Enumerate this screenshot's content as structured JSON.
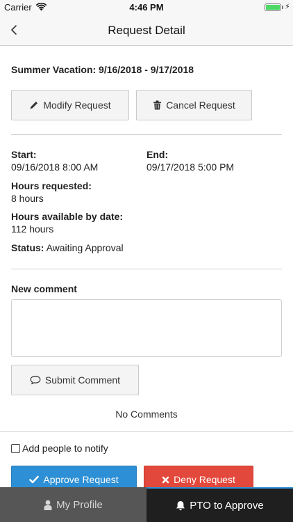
{
  "status_bar": {
    "carrier": "Carrier",
    "time": "4:46 PM"
  },
  "nav": {
    "title": "Request Detail"
  },
  "request": {
    "title": "Summer Vacation: 9/16/2018 - 9/17/2018",
    "modify_label": "Modify Request",
    "cancel_label": "Cancel Request"
  },
  "details": {
    "start_label": "Start:",
    "start_value": "09/16/2018 8:00 AM",
    "end_label": "End:",
    "end_value": "09/17/2018 5:00 PM",
    "hours_requested_label": "Hours requested:",
    "hours_requested_value": "8 hours",
    "hours_available_label": "Hours available by date:",
    "hours_available_value": "112 hours",
    "status_label": "Status:",
    "status_value": "Awaiting Approval"
  },
  "comments": {
    "new_comment_label": "New comment",
    "comment_value": "",
    "submit_label": "Submit Comment",
    "empty_text": "No Comments"
  },
  "notify": {
    "label": "Add people to notify",
    "checked": false
  },
  "actions": {
    "approve_label": "Approve Request",
    "deny_label": "Deny Request",
    "approve_color": "#2d8fd5",
    "deny_color": "#e2483b"
  },
  "tabs": [
    {
      "label": "My Profile",
      "icon": "user-icon",
      "active": false
    },
    {
      "label": "PTO to Approve",
      "icon": "bell-icon",
      "active": true
    }
  ],
  "colors": {
    "accent": "#2d8fd5",
    "tab_active_bg": "#1f1f1f",
    "tab_inactive_bg": "#565656"
  }
}
